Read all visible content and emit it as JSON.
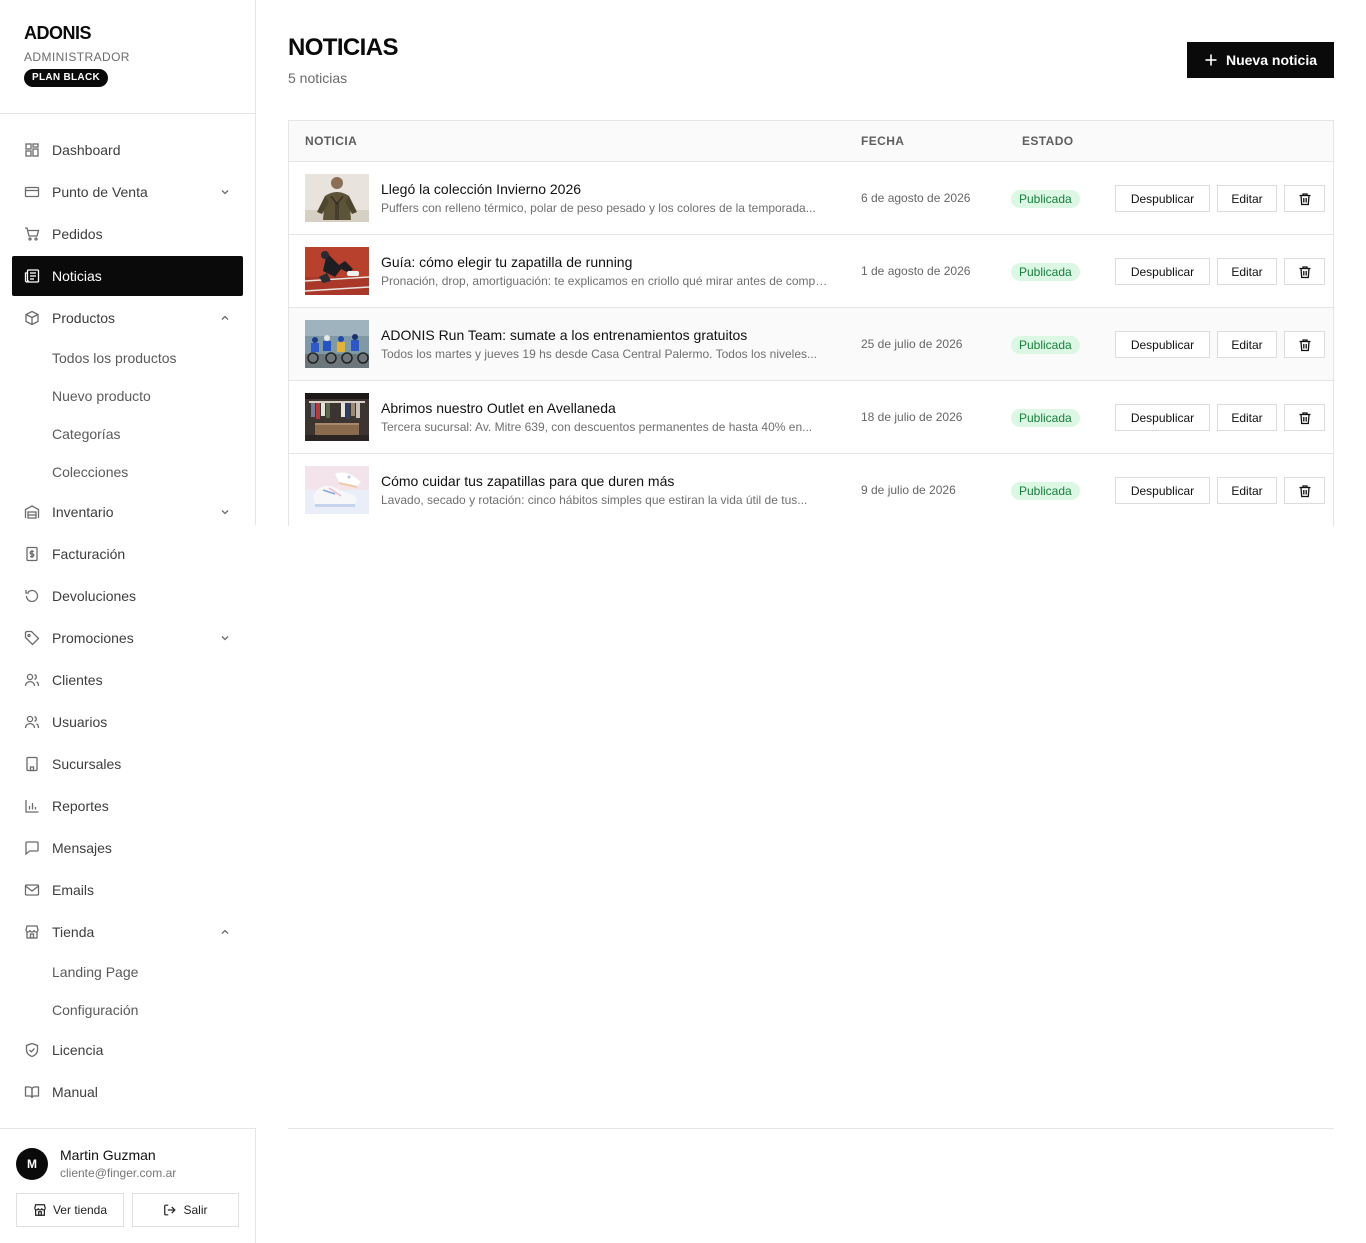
{
  "brand": {
    "name": "ADONIS",
    "role": "ADMINISTRADOR",
    "plan": "PLAN BLACK"
  },
  "nav": {
    "dashboard": "Dashboard",
    "pos": "Punto de Venta",
    "orders": "Pedidos",
    "news": "Noticias",
    "products": "Productos",
    "products_sub": [
      "Todos los productos",
      "Nuevo producto",
      "Categorías",
      "Colecciones"
    ],
    "inventory": "Inventario",
    "billing": "Facturación",
    "returns": "Devoluciones",
    "promotions": "Promociones",
    "customers": "Clientes",
    "users": "Usuarios",
    "branches": "Sucursales",
    "reports": "Reportes",
    "messages": "Mensajes",
    "emails": "Emails",
    "store": "Tienda",
    "store_sub": [
      "Landing Page",
      "Configuración"
    ],
    "license": "Licencia",
    "manual": "Manual"
  },
  "user": {
    "initial": "M",
    "name": "Martin Guzman",
    "email": "cliente@finger.com.ar",
    "view_store": "Ver tienda",
    "logout": "Salir"
  },
  "page": {
    "title": "NOTICIAS",
    "count": "5 noticias",
    "new_button": "Nueva noticia"
  },
  "table": {
    "headers": {
      "news": "NOTICIA",
      "date": "FECHA",
      "status": "ESTADO"
    },
    "actions": {
      "unpublish": "Despublicar",
      "edit": "Editar"
    },
    "rows": [
      {
        "title": "Llegó la colección Invierno 2026",
        "excerpt": "Puffers con relleno térmico, polar de peso pesado y los colores de la temporada...",
        "date": "6 de agosto de 2026",
        "status": "Publicada"
      },
      {
        "title": "Guía: cómo elegir tu zapatilla de running",
        "excerpt": "Pronación, drop, amortiguación: te explicamos en criollo qué mirar antes de comprar...",
        "date": "1 de agosto de 2026",
        "status": "Publicada"
      },
      {
        "title": "ADONIS Run Team: sumate a los entrenamientos gratuitos",
        "excerpt": "Todos los martes y jueves 19 hs desde Casa Central Palermo. Todos los niveles...",
        "date": "25 de julio de 2026",
        "status": "Publicada"
      },
      {
        "title": "Abrimos nuestro Outlet en Avellaneda",
        "excerpt": "Tercera sucursal: Av. Mitre 639, con descuentos permanentes de hasta 40% en...",
        "date": "18 de julio de 2026",
        "status": "Publicada"
      },
      {
        "title": "Cómo cuidar tus zapatillas para que duren más",
        "excerpt": "Lavado, secado y rotación: cinco hábitos simples que estiran la vida útil de tus...",
        "date": "9 de julio de 2026",
        "status": "Publicada"
      }
    ]
  },
  "colors": {
    "primary": "#0a0a0a",
    "badge_bg": "#dcf7e4",
    "badge_text": "#16803c",
    "border": "#e5e5e5"
  }
}
